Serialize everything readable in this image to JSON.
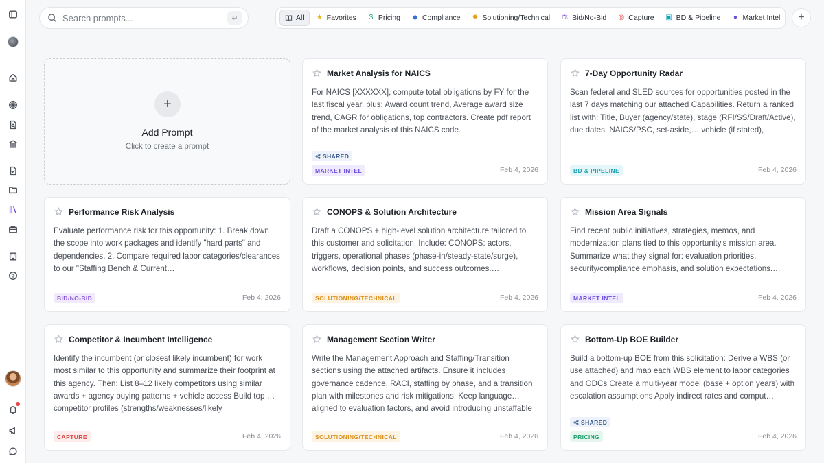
{
  "search": {
    "placeholder": "Search prompts...",
    "enter_hint": "↵"
  },
  "tabs": [
    {
      "label": "All",
      "icon": "book-icon",
      "active": true
    },
    {
      "label": "Favorites",
      "icon": "star-icon",
      "color": "#e3b21b"
    },
    {
      "label": "Pricing",
      "icon": "dollar-icon",
      "color": "#1fa37a"
    },
    {
      "label": "Compliance",
      "icon": "shield-icon",
      "color": "#3b6fd8"
    },
    {
      "label": "Solutioning/Technical",
      "icon": "gear-icon",
      "color": "#e39a1b"
    },
    {
      "label": "Bid/No-Bid",
      "icon": "scale-icon",
      "color": "#8a5ad8"
    },
    {
      "label": "Capture",
      "icon": "target-icon",
      "color": "#e5484d"
    },
    {
      "label": "BD & Pipeline",
      "icon": "chart-icon",
      "color": "#1aa3b8"
    },
    {
      "label": "Market Intel",
      "icon": "globe-icon",
      "color": "#6d4bd8"
    }
  ],
  "add_prompt": {
    "title": "Add Prompt",
    "subtitle": "Click to create a prompt"
  },
  "shared_label": "SHARED",
  "cards": [
    {
      "title": "Market Analysis for NAICS",
      "body": "For NAICS [XXXXXX], compute total obligations by FY for the last fiscal year, plus: Award count trend, Average award size trend, CAGR for obligations, top contractors. Create pdf report of the market analysis of this NAICS code.",
      "tag": "MARKET INTEL",
      "date": "Feb 4, 2026",
      "shared": true
    },
    {
      "title": "7-Day Opportunity Radar",
      "body": "Scan federal and SLED sources for opportunities posted in the last 7 days matching our attached Capabilities. Return a ranked list with: Title, Buyer (agency/state), stage (RFI/SS/Draft/Active), due dates, NAICS/PSC, set-aside,… vehicle (if stated), link/source, and why it matched (matched",
      "tag": "BD & PIPELINE",
      "date": "Feb 4, 2026",
      "shared": false
    },
    {
      "title": "Performance Risk Analysis",
      "body": "Evaluate performance risk for this opportunity: 1. Break down the scope into work packages and identify \"hard parts\" and dependencies. 2. Compare required labor categories/clearances to our \"Staffing Bench & Current…",
      "tag": "BID/NO-BID",
      "date": "Feb 4, 2026",
      "shared": false
    },
    {
      "title": "CONOPS & Solution Architecture",
      "body": "Draft a CONOPS + high-level solution architecture tailored to this customer and solicitation. Include: CONOPS: actors, triggers, operational phases (phase-in/steady-state/surge), workflows, decision points, and success outcomes.…",
      "tag": "SOLUTIONING/TECHNICAL",
      "date": "Feb 4, 2026",
      "shared": false
    },
    {
      "title": "Mission Area Signals",
      "body": "Find recent public initiatives, strategies, memos, and modernization plans tied to this opportunity's mission area. Summarize what they signal for: evaluation priorities, security/compliance emphasis, and solution expectations.…",
      "tag": "MARKET INTEL",
      "date": "Feb 4, 2026",
      "shared": false
    },
    {
      "title": "Competitor & Incumbent Intelligence",
      "body": "Identify the incumbent (or closest likely incumbent) for work most similar to this opportunity and summarize their footprint at this agency. Then: List 8–12 likely competitors using similar awards + agency buying patterns + vehicle access Build top … competitor profiles (strengths/weaknesses/likely",
      "tag": "CAPTURE",
      "date": "Feb 4, 2026",
      "shared": false
    },
    {
      "title": "Management Section Writer",
      "body": "Write the Management Approach and Staffing/Transition sections using the attached artifacts. Ensure it includes governance cadence, RACI, staffing by phase, and a transition plan with milestones and risk mitigations. Keep language… aligned to evaluation factors, and avoid introducing unstaffable",
      "tag": "SOLUTIONING/TECHNICAL",
      "date": "Feb 4, 2026",
      "shared": false
    },
    {
      "title": "Bottom-Up BOE Builder",
      "body": "Build a bottom-up BOE from this solicitation: Derive a WBS (or use attached) and map each WBS element to labor categories and ODCs Create a multi-year model (base + option years) with escalation assumptions Apply indirect rates and comput…",
      "tag": "PRICING",
      "date": "Feb 4, 2026",
      "shared": true
    }
  ],
  "tag_colors": {
    "MARKET INTEL": {
      "bg": "#efeafd",
      "fg": "#6d4bd8"
    },
    "BD & PIPELINE": {
      "bg": "#e5f6f9",
      "fg": "#1a9fb3"
    },
    "BID/NO-BID": {
      "bg": "#f1eafd",
      "fg": "#8a5ad8"
    },
    "SOLUTIONING/TECHNICAL": {
      "bg": "#fdf3e3",
      "fg": "#d9901a"
    },
    "CAPTURE": {
      "bg": "#fdeceb",
      "fg": "#d9463f"
    },
    "PRICING": {
      "bg": "#e6f6ef",
      "fg": "#1f9f6f"
    }
  }
}
